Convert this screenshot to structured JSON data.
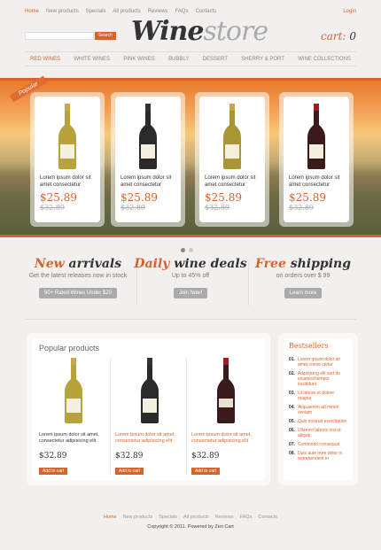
{
  "top_nav": [
    "Home",
    "New products",
    "Specials",
    "All products",
    "Reviews",
    "FAQs",
    "Contacts"
  ],
  "login_label": "Login",
  "search": {
    "button_label": "Search",
    "placeholder": ""
  },
  "logo": {
    "part1": "Wine",
    "part2": "store"
  },
  "cart": {
    "label": "cart:",
    "count": "0"
  },
  "categories": [
    "RED WINES",
    "WHITE WINES",
    "PINK WINES",
    "BUBBLY",
    "DESSERT",
    "SHERRY & PORT",
    "WINE COLLECTIONS"
  ],
  "slider": {
    "ribbon": "Popular",
    "cards": [
      {
        "desc": "Lorem ipsum dolor sit amet consectetur",
        "price": "$25.89",
        "old_price": "$32.89",
        "bottle": "white"
      },
      {
        "desc": "Lorem ipsum dolor sit amet consectetur",
        "price": "$25.89",
        "old_price": "$32.89",
        "bottle": "red"
      },
      {
        "desc": "Lorem ipsum dolor sit amet consectetur",
        "price": "$25.89",
        "old_price": "$32.89",
        "bottle": "white"
      },
      {
        "desc": "Lorem ipsum dolor sit amet consectetur",
        "price": "$25.89",
        "old_price": "$32.89",
        "bottle": "red"
      }
    ]
  },
  "promos": [
    {
      "title_hl": "New",
      "title_rest": " arrivals",
      "sub": "Get the latest releases now in stock",
      "button": "90+ Rated  Wines Under $20"
    },
    {
      "title_hl": "Daily",
      "title_rest": " wine deals",
      "sub": "Up to 45% off",
      "button": "Join Now!"
    },
    {
      "title_hl": "Free",
      "title_rest": " shipping",
      "sub": "on orders over $ 99",
      "button": "Learn more"
    }
  ],
  "popular": {
    "title": "Popular products",
    "products": [
      {
        "desc": "Lorem ipsum dolor sit amet, consectetur adipisicing elit",
        "price": "$32.89",
        "button": "Add to cart",
        "bottle": "white"
      },
      {
        "desc": "Lorem ipsum dolor sit amet, consectetur adipisicing elit",
        "price": "$32.89",
        "button": "Add to cart",
        "bottle": "red"
      },
      {
        "desc": "Lorem ipsum dolor sit amet, consectetur adipisicing elit",
        "price": "$32.89",
        "button": "Add to cart",
        "bottle": "red"
      }
    ]
  },
  "bestsellers": {
    "title": "Bestsellers",
    "items": [
      {
        "n": "01.",
        "t": "Lorem ipsum dolor sit amet conse ctetur"
      },
      {
        "n": "02.",
        "t": "Adipisicing elit sed do eiusmod tempor incididunt"
      },
      {
        "n": "03.",
        "t": "Ut labore et dolore magna"
      },
      {
        "n": "04.",
        "t": "Aliquaenim ad minim veniam"
      },
      {
        "n": "05.",
        "t": "Quis nostrud exercitation"
      },
      {
        "n": "06.",
        "t": "Ullamco laboris nisi ut aliquip"
      },
      {
        "n": "07.",
        "t": "Commodo consequat"
      },
      {
        "n": "08.",
        "t": "Duis aute irure dolor in reprehenderit in"
      }
    ]
  },
  "footer_nav": [
    "Home",
    "New products",
    "Specials",
    "All products",
    "Reviews",
    "FAQs",
    "Contacts"
  ],
  "copyright": "Copyright © 2011. Powered by Zen Cart",
  "colors": {
    "accent": "#d9622b",
    "background": "#f1f0ee"
  }
}
